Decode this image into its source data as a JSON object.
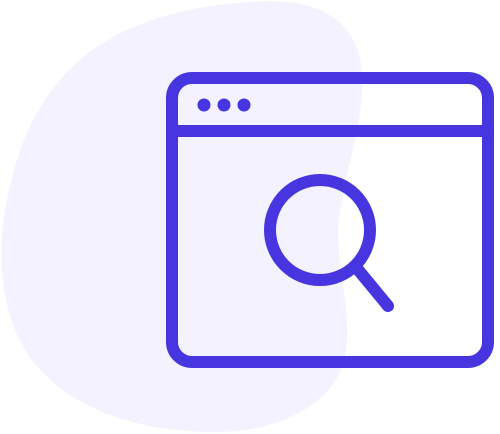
{
  "illustration": {
    "icon": "browser-search-icon",
    "colors": {
      "accent": "#4735E0",
      "blob": "#F3F2FE",
      "background": "#FFFFFF"
    }
  }
}
